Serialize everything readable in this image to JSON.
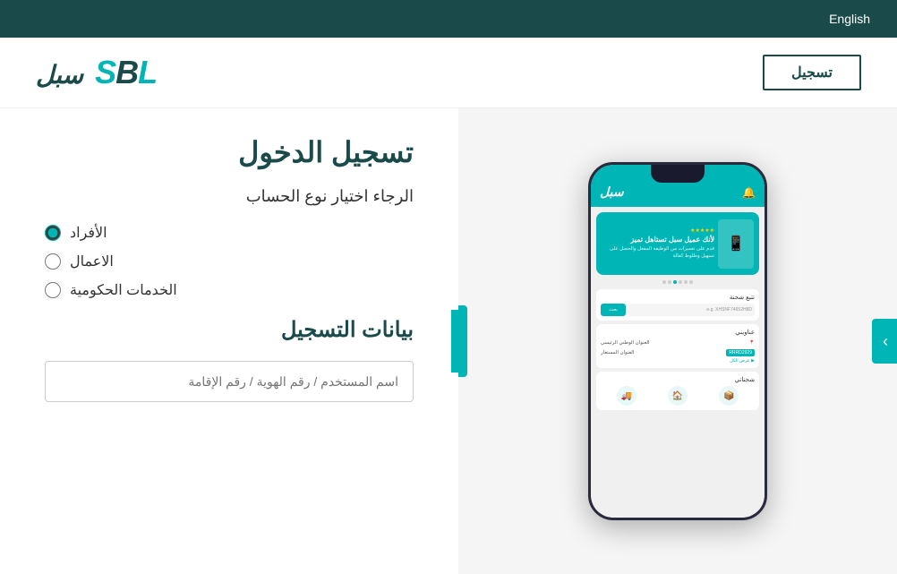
{
  "topbar": {
    "lang_label": "English"
  },
  "header": {
    "register_btn": "تسجيل",
    "logo_main": "سبل",
    "logo_prefix": "SBL"
  },
  "phone": {
    "logo": "سبل",
    "banner_title": "لأنك عميل سبل تستاهل تميز",
    "banner_sub": "قدم على تعميرات من الوظيفة المفعل والحصل على تسهيل وطلوط كفالة",
    "track_title": "تتبع شحنة",
    "track_placeholder": "e.g. XHSNF74652H8D",
    "track_btn": "بحث",
    "address_title": "عناويني",
    "address_label1": "العنوان الوطني الرئيسي",
    "address_label2": "العنوان المستعار",
    "address_code": "RRRD2929",
    "show_all": "▶ عرض الكل",
    "shipments_title": "شحناتي",
    "dots": [
      false,
      false,
      false,
      true,
      false,
      false
    ]
  },
  "form": {
    "title": "تسجيل الدخول",
    "subtitle": "الرجاء اختيار نوع الحساب",
    "radio_options": [
      {
        "label": "الأفراد",
        "value": "individuals",
        "checked": true
      },
      {
        "label": "الاعمال",
        "value": "business",
        "checked": false
      },
      {
        "label": "الخدمات الحكومية",
        "value": "government",
        "checked": false
      }
    ],
    "registration_data_title": "بيانات التسجيل",
    "username_placeholder": "اسم المستخدم / رقم الهوية / رقم الإقامة"
  }
}
